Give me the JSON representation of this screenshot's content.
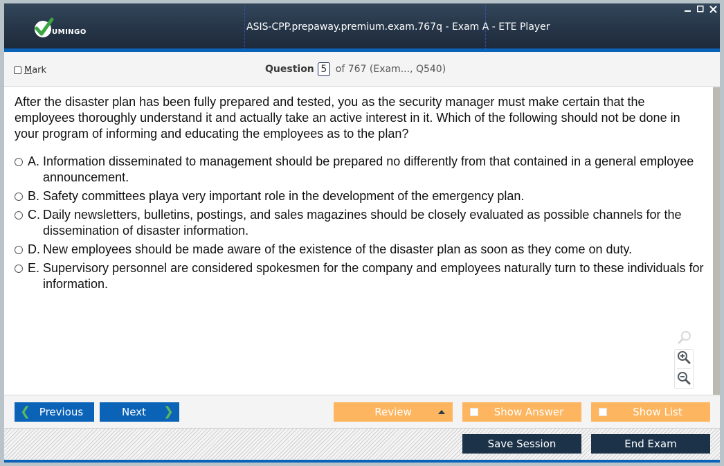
{
  "app": {
    "logo_text": "UMINGO",
    "title": "ASIS-CPP.prepaway.premium.exam.767q - Exam A - ETE Player",
    "window_controls": [
      "minimize-icon",
      "maximize-icon",
      "close-icon"
    ]
  },
  "question_bar": {
    "mark_label_prefix": "M",
    "mark_label_rest": "ark",
    "mark_checked": false,
    "question_label": "Question",
    "question_number": "5",
    "question_of": "of 767 (Exam..., Q540)"
  },
  "question": {
    "text": "After the disaster plan has been fully prepared and tested, you as the security manager must make certain that the employees thoroughly understand it and actually take an active interest in it. Which of the following should not be done in your program of informing and educating the employees as to the plan?",
    "options": [
      {
        "letter": "A.",
        "text": "Information disseminated to management should be prepared no differently from that contained in a general employee announcement.",
        "selected": false
      },
      {
        "letter": "B.",
        "text": "Safety committees playa very important role in the development of the emergency plan.",
        "selected": false
      },
      {
        "letter": "C.",
        "text": "Daily newsletters, bulletins, postings, and sales magazines should be closely evaluated as possible channels for the dissemination of disaster information.",
        "selected": false
      },
      {
        "letter": "D.",
        "text": "New employees should be made aware of the existence of the disaster plan as soon as they come on duty.",
        "selected": false
      },
      {
        "letter": "E.",
        "text": "Supervisory personnel are considered spokesmen for the company and employees naturally turn to these individuals for information.",
        "selected": false
      }
    ]
  },
  "zoom_tools": [
    "zoom-icon",
    "zoom-in-icon",
    "zoom-out-icon"
  ],
  "nav": {
    "previous": "Previous",
    "next": "Next",
    "review": "Review",
    "show_answer": "Show Answer",
    "show_list": "Show List",
    "save_session": "Save Session",
    "end_exam": "End Exam"
  },
  "colors": {
    "primary_blue": "#0b63b8",
    "accent_orange": "#fdb55f",
    "dark_navy": "#1b3249",
    "chevron_green": "#5ab95a"
  }
}
